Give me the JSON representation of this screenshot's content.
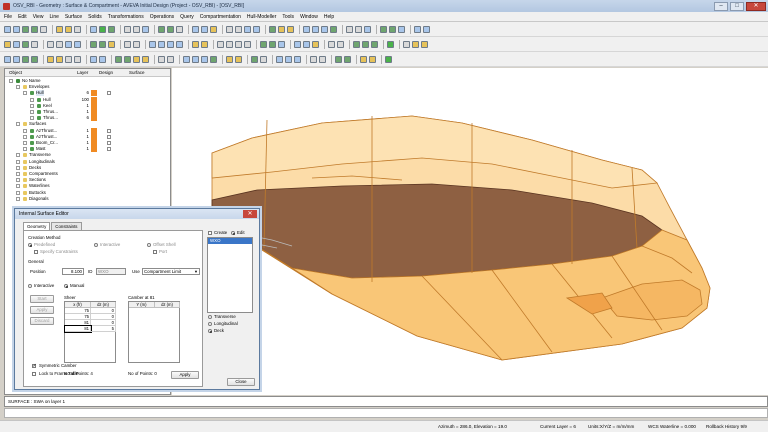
{
  "window": {
    "title": "OSV_RBI - Geometry : Surface & Compartment - AVEVA Initial Design (Project - OSV_RBI) - [OSV_RBI]",
    "buttons": [
      "–",
      "□",
      "✕"
    ]
  },
  "menu": [
    "File",
    "Edit",
    "View",
    "Line",
    "Surface",
    "Solids",
    "Transformations",
    "Operations",
    "Query",
    "Compartmentation",
    "Hull-Modeller",
    "Tools",
    "Window",
    "Help"
  ],
  "tree": {
    "headers": {
      "object": "Object",
      "layer": "Layer",
      "design": "Design",
      "surface": "Surface"
    },
    "rows": [
      {
        "label": "No Name",
        "level": 0,
        "icon": "model-icon"
      },
      {
        "label": "Envelopes",
        "level": 1,
        "icon": "folder-icon"
      },
      {
        "label": "Hull",
        "level": 2,
        "layer": "6",
        "orange": true,
        "check": true,
        "selected": true,
        "icon": "surface-icon"
      },
      {
        "label": "Hull",
        "level": 3,
        "layer": "100",
        "orange": true,
        "icon": "surface-icon"
      },
      {
        "label": "Keel",
        "level": 3,
        "layer": "1",
        "orange": true,
        "icon": "surface-icon"
      },
      {
        "label": "Thrus...",
        "level": 3,
        "layer": "1",
        "orange": true,
        "icon": "surface-icon"
      },
      {
        "label": "Thrus...",
        "level": 3,
        "layer": "6",
        "orange": true,
        "icon": "surface-icon"
      },
      {
        "label": "Surfaces",
        "level": 1,
        "icon": "folder-icon"
      },
      {
        "label": "AzThrust...",
        "level": 2,
        "layer": "1",
        "orange": true,
        "check": true,
        "icon": "surface-icon"
      },
      {
        "label": "AzThrust...",
        "level": 2,
        "layer": "1",
        "orange": true,
        "check": true,
        "icon": "surface-icon"
      },
      {
        "label": "Boom_Cr...",
        "level": 2,
        "layer": "1",
        "orange": true,
        "check": true,
        "icon": "surface-icon"
      },
      {
        "label": "Mast",
        "level": 2,
        "layer": "1",
        "orange": true,
        "check": true,
        "icon": "surface-icon"
      },
      {
        "label": "Transverse",
        "level": 1,
        "icon": "folder-icon"
      },
      {
        "label": "Longitudinals",
        "level": 1,
        "icon": "folder-icon"
      },
      {
        "label": "Decks",
        "level": 1,
        "icon": "folder-icon"
      },
      {
        "label": "Compartments",
        "level": 1,
        "icon": "folder-icon"
      },
      {
        "label": "Sections",
        "level": 1,
        "icon": "folder-icon"
      },
      {
        "label": "Waterlines",
        "level": 1,
        "icon": "folder-icon"
      },
      {
        "label": "Buttocks",
        "level": 1,
        "icon": "folder-icon"
      },
      {
        "label": "Diagonals",
        "level": 1,
        "icon": "folder-icon"
      }
    ]
  },
  "dialog": {
    "title": "Internal Surface Editor",
    "close": "✕",
    "tabs": [
      "Geometry",
      "Constraints"
    ],
    "creation_method_label": "Creation Method",
    "predefined": "Predefined",
    "interactive": "Interactive",
    "offset_shell": "Offset Shell",
    "specify_constraints": "Specify Constraints",
    "port": "Port",
    "general_label": "General",
    "position_label": "Position",
    "position_value": "8.100",
    "id_label": "ID",
    "id_value": "WXO",
    "use_label": "Use",
    "use_value": "Compartment Limit",
    "interactive_radio": "Interactive",
    "manual_radio": "Manual",
    "start": "Start",
    "apply_small": "Apply",
    "discard": "Discard",
    "sheer_label": "Sheer",
    "sheer_headers": [
      "x (fr)",
      "dz (m)"
    ],
    "sheer_rows": [
      [
        "75",
        "0"
      ],
      [
        "75",
        "0"
      ],
      [
        "81",
        "0"
      ],
      [
        "81",
        "5"
      ]
    ],
    "camber_label": "Camber at 81",
    "camber_headers": [
      "Y (m)",
      "dz (m)"
    ],
    "no_points_sheer": "No of Points: 4",
    "no_points_camber": "No of Points: 0",
    "symmetric_camber": "Symmetric Camber",
    "lock_frame": "Lock to Frame Table",
    "apply": "Apply",
    "create": "Create",
    "edit": "Edit",
    "list_item": "WXO",
    "transverse": "Transverse",
    "longitudinal": "Longitudinal",
    "deck": "Deck",
    "close_btn": "Close"
  },
  "command": {
    "line": "SURFACE : SWA on layer 1"
  },
  "status": {
    "azimuth": "Azimuth = 286.0, Elevation = 19.0",
    "layer": "Current Layer = 6",
    "units": "Units:X/Y/Z = m/m/mm",
    "waterline": "WCS Waterline = 0.000",
    "rollback": "Rollback History 9/9"
  },
  "colors": {
    "hull_fill": "#f8c676",
    "hull_stroke": "#c07a2a",
    "deck": "#7a4a30",
    "layer_swatch": "#f08a22",
    "selection": "#3a76c8"
  }
}
